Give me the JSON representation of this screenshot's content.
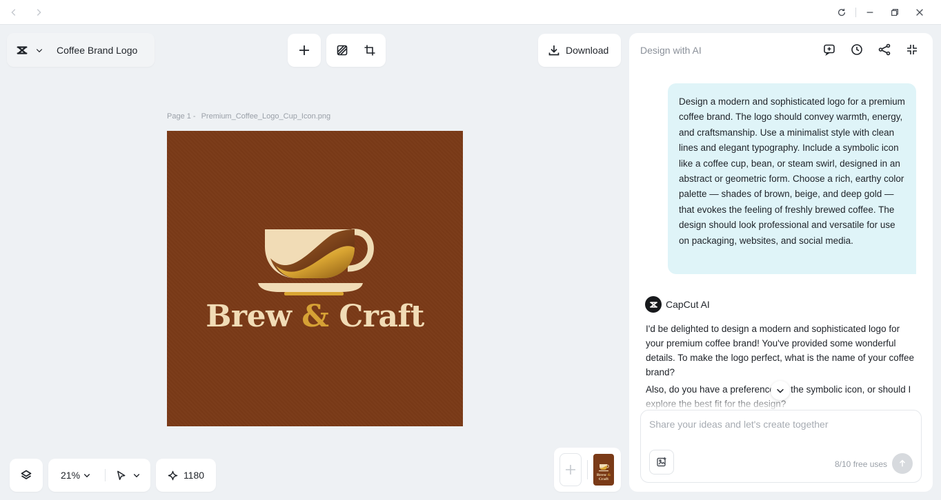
{
  "window": {
    "controls": [
      "back-arrow-icon",
      "forward-arrow-icon",
      "refresh-icon",
      "minimize-icon",
      "restore-icon",
      "close-icon"
    ]
  },
  "header": {
    "document_title": "Coffee Brand Logo",
    "download_label": "Download"
  },
  "canvas": {
    "page_prefix": "Page 1 -",
    "file_name": "Premium_Coffee_Logo_Cup_Icon.png",
    "logo": {
      "brand_left": "Brew ",
      "ampersand": "&",
      "brand_right": " Craft",
      "background_color": "#7a3a17",
      "text_color": "#f1dcb6",
      "accent_color": "#d6a135"
    }
  },
  "bottom_bar": {
    "zoom": "21%",
    "credits": "1180"
  },
  "panel": {
    "title": "Design with AI",
    "user_message": "Design a modern and sophisticated logo for a premium coffee brand. The logo should convey warmth, energy, and craftsmanship. Use a minimalist style with clean lines and elegant typography. Include a symbolic icon like a coffee cup, bean, or steam swirl, designed in an abstract or geometric form. Choose a rich, earthy color palette — shades of brown, beige, and deep gold — that evokes the feeling of freshly brewed coffee. The design should look professional and versatile for use on packaging, websites, and social media.",
    "ai_name": "CapCut AI",
    "ai_message_1": "I'd be delighted to design a modern and sophisticated logo for your premium coffee brand! You've provided some wonderful details. To make the logo perfect, what is the name of your coffee brand?",
    "ai_message_2": "Also, do you have a preference for the symbolic icon, or should I explore the best fit for the design?",
    "composer_placeholder": "Share your ideas and let's create together",
    "free_uses": "8/10 free uses"
  }
}
